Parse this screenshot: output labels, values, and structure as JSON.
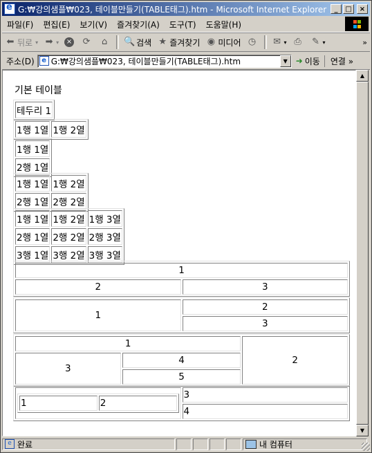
{
  "window": {
    "title": "G:₩강의샘플₩023, 테이블만들기(TABLE태그).htm - Microsoft Internet Explorer",
    "min": "_",
    "max": "□",
    "close": "×"
  },
  "menu": [
    "파일(F)",
    "편집(E)",
    "보기(V)",
    "즐겨찾기(A)",
    "도구(T)",
    "도움말(H)"
  ],
  "toolbar": {
    "back": "뒤로",
    "search": "검색",
    "favorites": "즐겨찾기",
    "media": "미디어"
  },
  "address": {
    "label": "주소(D)",
    "url": "G:₩강의샘플₩023, 테이블만들기(TABLE태그).htm",
    "go": "이동",
    "links": "연결 »"
  },
  "page": {
    "heading": "기본 테이블",
    "t1": [
      "테두리 1"
    ],
    "t2": [
      "1행 1열",
      "1행 2열"
    ],
    "t3": [
      "1행 1열",
      "2행 1열"
    ],
    "t4": [
      [
        "1행 1열",
        "1행 2열"
      ],
      [
        "2행 1열",
        "2행 2열"
      ]
    ],
    "t5": [
      [
        "1행 1열",
        "1행 2열",
        "1행 3열"
      ],
      [
        "2행 1열",
        "2행 2열",
        "2행 3열"
      ],
      [
        "3행 1열",
        "3행 2열",
        "3행 3열"
      ]
    ],
    "t6": [
      "1",
      "2",
      "3"
    ],
    "t7": [
      "1",
      "2",
      "3"
    ],
    "t8": [
      "1",
      "2",
      "3",
      "4",
      "5"
    ],
    "t9": [
      "1",
      "2",
      "3",
      "4"
    ]
  },
  "status": {
    "text": "완료",
    "zone": "내 컴퓨터"
  }
}
